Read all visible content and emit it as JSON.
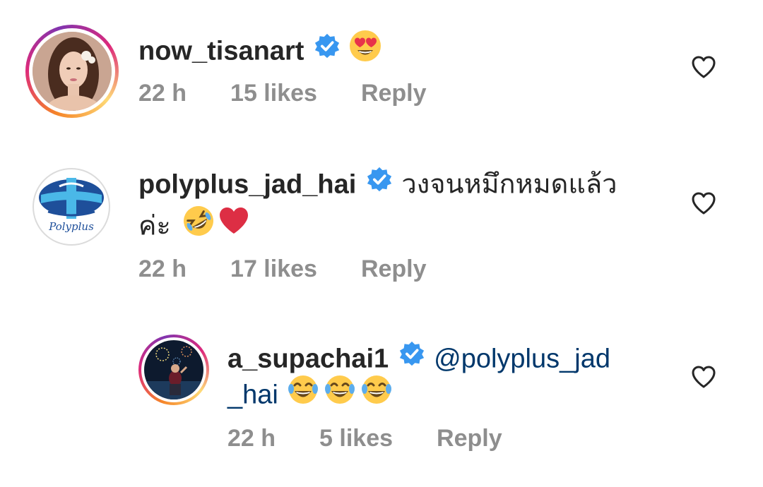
{
  "comments": [
    {
      "username": "now_tisanart",
      "verified": true,
      "text": "",
      "emoji": [
        "heart-eyes"
      ],
      "time": "22 h",
      "likes": "15 likes",
      "reply_label": "Reply"
    },
    {
      "username": "polyplus_jad_hai",
      "verified": true,
      "text_line1": "วงจนหมึกหมดแล้ว",
      "text_line2": "ค่ะ",
      "emoji": [
        "rolling-laughing",
        "red-heart"
      ],
      "time": "22 h",
      "likes": "17 likes",
      "reply_label": "Reply",
      "avatar_logo_text": "Polyplus"
    },
    {
      "username": "a_supachai1",
      "verified": true,
      "mention_line1": "@polyplus_jad",
      "mention_line2": "_hai",
      "emoji": [
        "tears-of-joy",
        "tears-of-joy",
        "tears-of-joy"
      ],
      "time": "22 h",
      "likes": "5 likes",
      "reply_label": "Reply"
    }
  ],
  "colors": {
    "verified_blue": "#3897f0",
    "secondary_text": "#8e8e8e",
    "mention": "#00376b"
  }
}
